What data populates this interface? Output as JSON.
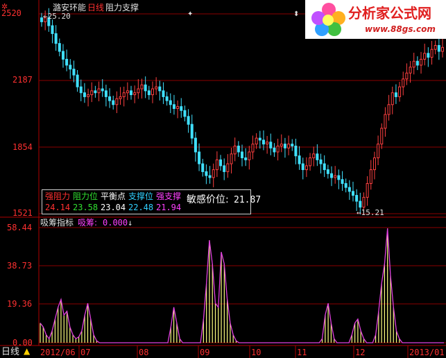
{
  "header": {
    "stock_name": "潞安环能",
    "period_label": "日线",
    "indicator_name": "阻力支撑",
    "high_marker": "25.20",
    "low_marker": "15.21",
    "star_icon": "gear-icon"
  },
  "price_axis": {
    "ticks": [
      "2520",
      "2187",
      "1854",
      "1521"
    ]
  },
  "indicator_axis": {
    "ticks": [
      "58.44",
      "38.73",
      "19.36",
      "0.00"
    ]
  },
  "info_box": {
    "items": [
      {
        "label": "强阻力",
        "value": "24.14",
        "color": "#ff3030"
      },
      {
        "label": "阻力位",
        "value": "23.58",
        "color": "#30e030"
      },
      {
        "label": "平衡点",
        "value": "23.04",
        "color": "#ffffff"
      },
      {
        "label": "支撑位",
        "value": "22.48",
        "color": "#30d0ff"
      },
      {
        "label": "强支撑",
        "value": "21.94",
        "color": "#ff40ff"
      }
    ],
    "sensitive_label": "敏感价位:",
    "sensitive_value": "21.87"
  },
  "indicator_header": {
    "title": "吸筹指标",
    "series_label": "吸筹:",
    "series_value": "0.000"
  },
  "x_axis": {
    "period_tab": "日线",
    "labels": [
      "2012/06",
      "07",
      "08",
      "09",
      "10",
      "11",
      "12",
      "2013/01"
    ]
  },
  "logo": {
    "title": "分析家公式网",
    "url_text": "www.88gs.com"
  },
  "colors": {
    "up": "#ff4040",
    "down": "#40e0ff",
    "grid": "#8b0000",
    "bar": "#ffff80",
    "line": "#e040e0"
  },
  "chart_data": [
    {
      "type": "candlestick",
      "title": "潞安环能 日线",
      "ylim": [
        15.21,
        25.2
      ],
      "close": [
        24.8,
        25.0,
        24.6,
        24.2,
        23.7,
        23.3,
        22.9,
        22.6,
        22.4,
        22.1,
        21.5,
        21.2,
        21.0,
        21.1,
        21.3,
        21.2,
        21.4,
        21.3,
        21.0,
        20.8,
        20.6,
        20.9,
        21.0,
        21.2,
        21.3,
        21.1,
        21.2,
        21.4,
        21.6,
        21.3,
        21.1,
        21.4,
        21.5,
        21.3,
        21.0,
        20.8,
        20.6,
        20.4,
        20.5,
        20.3,
        20.0,
        19.6,
        18.9,
        18.2,
        17.6,
        17.2,
        17.0,
        16.9,
        17.3,
        17.8,
        17.5,
        17.2,
        17.6,
        18.1,
        18.5,
        18.2,
        17.9,
        17.8,
        18.2,
        18.6,
        18.9,
        18.8,
        18.6,
        18.7,
        18.4,
        18.2,
        18.5,
        18.6,
        18.4,
        18.6,
        18.5,
        18.0,
        17.6,
        17.3,
        17.5,
        17.9,
        18.1,
        17.8,
        17.6,
        17.3,
        17.1,
        16.9,
        17.0,
        16.8,
        16.6,
        16.4,
        16.2,
        16.0,
        15.7,
        15.4,
        15.9,
        16.6,
        17.3,
        17.9,
        18.6,
        19.4,
        20.1,
        20.6,
        21.2,
        21.0,
        21.5,
        21.9,
        22.2,
        22.5,
        22.8,
        22.6,
        22.9,
        23.2,
        23.0,
        23.4,
        23.6,
        23.3,
        23.5
      ]
    },
    {
      "type": "bar",
      "title": "吸筹指标",
      "ylim": [
        0,
        58.44
      ],
      "values": [
        10,
        8,
        4,
        2,
        6,
        12,
        18,
        22,
        14,
        16,
        8,
        4,
        2,
        3,
        6,
        14,
        20,
        12,
        4,
        1,
        0,
        0,
        0,
        0,
        0,
        0,
        0,
        0,
        0,
        0,
        0,
        0,
        0,
        0,
        0,
        0,
        0,
        0,
        0,
        0,
        0,
        0,
        0,
        0,
        8,
        18,
        10,
        2,
        0,
        0,
        0,
        0,
        0,
        0,
        0,
        12,
        30,
        52,
        40,
        20,
        18,
        46,
        40,
        22,
        10,
        4,
        1,
        0,
        0,
        0,
        0,
        0,
        0,
        0,
        0,
        0,
        0,
        0,
        0,
        0,
        0,
        0,
        0,
        0,
        0,
        0,
        0,
        0,
        0,
        0,
        0,
        0,
        0,
        0,
        0,
        2,
        14,
        20,
        10,
        2,
        0,
        0,
        0,
        0,
        0,
        4,
        10,
        12,
        6,
        2,
        0,
        0,
        0,
        4,
        16,
        30,
        40,
        58,
        34,
        18,
        6,
        2,
        0,
        0,
        0,
        0,
        0,
        0,
        0,
        0,
        0,
        0,
        0,
        0,
        0,
        0,
        0
      ]
    }
  ]
}
